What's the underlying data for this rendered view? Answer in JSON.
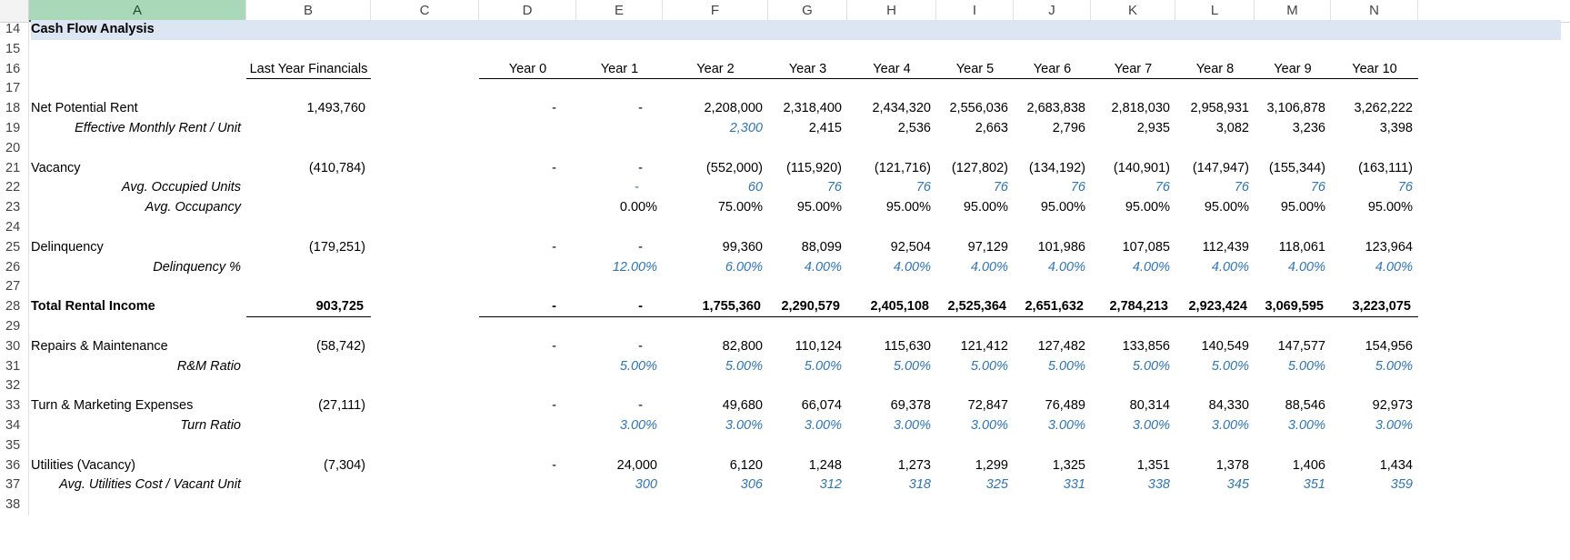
{
  "columns": [
    "A",
    "B",
    "C",
    "D",
    "E",
    "F",
    "G",
    "H",
    "I",
    "J",
    "K",
    "L",
    "M",
    "N"
  ],
  "rows": [
    {
      "num": "14",
      "cells": {
        "A": {
          "t": "Cash Flow Analysis",
          "s": "title"
        }
      }
    },
    {
      "num": "15",
      "cells": {}
    },
    {
      "num": "16",
      "cells": {
        "B": {
          "t": "Last Year Financials",
          "s": "hdr"
        },
        "D": {
          "t": "Year 0",
          "s": "hdr"
        },
        "E": {
          "t": "Year 1",
          "s": "hdr"
        },
        "F": {
          "t": "Year 2",
          "s": "hdr"
        },
        "G": {
          "t": "Year 3",
          "s": "hdr"
        },
        "H": {
          "t": "Year 4",
          "s": "hdr"
        },
        "I": {
          "t": "Year 5",
          "s": "hdr"
        },
        "J": {
          "t": "Year 6",
          "s": "hdr"
        },
        "K": {
          "t": "Year 7",
          "s": "hdr"
        },
        "L": {
          "t": "Year 8",
          "s": "hdr"
        },
        "M": {
          "t": "Year 9",
          "s": "hdr"
        },
        "N": {
          "t": "Year 10",
          "s": "hdr"
        }
      }
    },
    {
      "num": "17",
      "cells": {}
    },
    {
      "num": "18",
      "cells": {
        "A": {
          "t": "Net Potential Rent",
          "s": "label"
        },
        "B": {
          "t": "1,493,760",
          "s": "num"
        },
        "D": {
          "t": "-",
          "s": "dash"
        },
        "E": {
          "t": "-",
          "s": "dash"
        },
        "F": {
          "t": "2,208,000",
          "s": "num"
        },
        "G": {
          "t": "2,318,400",
          "s": "num"
        },
        "H": {
          "t": "2,434,320",
          "s": "num"
        },
        "I": {
          "t": "2,556,036",
          "s": "num"
        },
        "J": {
          "t": "2,683,838",
          "s": "num"
        },
        "K": {
          "t": "2,818,030",
          "s": "num"
        },
        "L": {
          "t": "2,958,931",
          "s": "num"
        },
        "M": {
          "t": "3,106,878",
          "s": "num"
        },
        "N": {
          "t": "3,262,222",
          "s": "num"
        }
      }
    },
    {
      "num": "19",
      "cells": {
        "A": {
          "t": "Effective Monthly Rent / Unit",
          "s": "sublabel"
        },
        "F": {
          "t": "2,300",
          "s": "bluenum"
        },
        "G": {
          "t": "2,415",
          "s": "num"
        },
        "H": {
          "t": "2,536",
          "s": "num"
        },
        "I": {
          "t": "2,663",
          "s": "num"
        },
        "J": {
          "t": "2,796",
          "s": "num"
        },
        "K": {
          "t": "2,935",
          "s": "num"
        },
        "L": {
          "t": "3,082",
          "s": "num"
        },
        "M": {
          "t": "3,236",
          "s": "num"
        },
        "N": {
          "t": "3,398",
          "s": "num"
        }
      }
    },
    {
      "num": "20",
      "cells": {}
    },
    {
      "num": "21",
      "cells": {
        "A": {
          "t": "Vacancy",
          "s": "label"
        },
        "B": {
          "t": "(410,784)",
          "s": "num"
        },
        "D": {
          "t": "-",
          "s": "dash"
        },
        "E": {
          "t": "-",
          "s": "dash"
        },
        "F": {
          "t": "(552,000)",
          "s": "num"
        },
        "G": {
          "t": "(115,920)",
          "s": "num"
        },
        "H": {
          "t": "(121,716)",
          "s": "num"
        },
        "I": {
          "t": "(127,802)",
          "s": "num"
        },
        "J": {
          "t": "(134,192)",
          "s": "num"
        },
        "K": {
          "t": "(140,901)",
          "s": "num"
        },
        "L": {
          "t": "(147,947)",
          "s": "num"
        },
        "M": {
          "t": "(155,344)",
          "s": "num"
        },
        "N": {
          "t": "(163,111)",
          "s": "num"
        }
      }
    },
    {
      "num": "22",
      "cells": {
        "A": {
          "t": "Avg. Occupied Units",
          "s": "sublabel"
        },
        "E": {
          "t": "-",
          "s": "bluedash"
        },
        "F": {
          "t": "60",
          "s": "bluenum"
        },
        "G": {
          "t": "76",
          "s": "bluenum"
        },
        "H": {
          "t": "76",
          "s": "bluenum"
        },
        "I": {
          "t": "76",
          "s": "bluenum"
        },
        "J": {
          "t": "76",
          "s": "bluenum"
        },
        "K": {
          "t": "76",
          "s": "bluenum"
        },
        "L": {
          "t": "76",
          "s": "bluenum"
        },
        "M": {
          "t": "76",
          "s": "bluenum"
        },
        "N": {
          "t": "76",
          "s": "bluenum"
        }
      }
    },
    {
      "num": "23",
      "cells": {
        "A": {
          "t": "Avg. Occupancy",
          "s": "sublabel"
        },
        "E": {
          "t": "0.00%",
          "s": "num"
        },
        "F": {
          "t": "75.00%",
          "s": "num"
        },
        "G": {
          "t": "95.00%",
          "s": "num"
        },
        "H": {
          "t": "95.00%",
          "s": "num"
        },
        "I": {
          "t": "95.00%",
          "s": "num"
        },
        "J": {
          "t": "95.00%",
          "s": "num"
        },
        "K": {
          "t": "95.00%",
          "s": "num"
        },
        "L": {
          "t": "95.00%",
          "s": "num"
        },
        "M": {
          "t": "95.00%",
          "s": "num"
        },
        "N": {
          "t": "95.00%",
          "s": "num"
        }
      }
    },
    {
      "num": "24",
      "cells": {}
    },
    {
      "num": "25",
      "cells": {
        "A": {
          "t": "Delinquency",
          "s": "label"
        },
        "B": {
          "t": "(179,251)",
          "s": "num"
        },
        "D": {
          "t": "-",
          "s": "dash"
        },
        "E": {
          "t": "-",
          "s": "dash"
        },
        "F": {
          "t": "99,360",
          "s": "num"
        },
        "G": {
          "t": "88,099",
          "s": "num"
        },
        "H": {
          "t": "92,504",
          "s": "num"
        },
        "I": {
          "t": "97,129",
          "s": "num"
        },
        "J": {
          "t": "101,986",
          "s": "num"
        },
        "K": {
          "t": "107,085",
          "s": "num"
        },
        "L": {
          "t": "112,439",
          "s": "num"
        },
        "M": {
          "t": "118,061",
          "s": "num"
        },
        "N": {
          "t": "123,964",
          "s": "num"
        }
      }
    },
    {
      "num": "26",
      "cells": {
        "A": {
          "t": "Delinquency %",
          "s": "sublabel"
        },
        "E": {
          "t": "12.00%",
          "s": "bluepct"
        },
        "F": {
          "t": "6.00%",
          "s": "bluepct"
        },
        "G": {
          "t": "4.00%",
          "s": "bluepct"
        },
        "H": {
          "t": "4.00%",
          "s": "bluepct"
        },
        "I": {
          "t": "4.00%",
          "s": "bluepct"
        },
        "J": {
          "t": "4.00%",
          "s": "bluepct"
        },
        "K": {
          "t": "4.00%",
          "s": "bluepct"
        },
        "L": {
          "t": "4.00%",
          "s": "bluepct"
        },
        "M": {
          "t": "4.00%",
          "s": "bluepct"
        },
        "N": {
          "t": "4.00%",
          "s": "bluepct"
        }
      }
    },
    {
      "num": "27",
      "cells": {}
    },
    {
      "num": "28",
      "cells": {
        "A": {
          "t": "Total Rental Income",
          "s": "boldlabel"
        },
        "B": {
          "t": "903,725",
          "s": "boldnum"
        },
        "D": {
          "t": "-",
          "s": "bolddash"
        },
        "E": {
          "t": "-",
          "s": "bolddash"
        },
        "F": {
          "t": "1,755,360",
          "s": "boldnum"
        },
        "G": {
          "t": "2,290,579",
          "s": "boldnum"
        },
        "H": {
          "t": "2,405,108",
          "s": "boldnum"
        },
        "I": {
          "t": "2,525,364",
          "s": "boldnum"
        },
        "J": {
          "t": "2,651,632",
          "s": "boldnum"
        },
        "K": {
          "t": "2,784,213",
          "s": "boldnum"
        },
        "L": {
          "t": "2,923,424",
          "s": "boldnum"
        },
        "M": {
          "t": "3,069,595",
          "s": "boldnum"
        },
        "N": {
          "t": "3,223,075",
          "s": "boldnum"
        }
      }
    },
    {
      "num": "29",
      "cells": {}
    },
    {
      "num": "30",
      "cells": {
        "A": {
          "t": "Repairs & Maintenance",
          "s": "label"
        },
        "B": {
          "t": "(58,742)",
          "s": "num"
        },
        "D": {
          "t": "-",
          "s": "dash"
        },
        "E": {
          "t": "-",
          "s": "dash"
        },
        "F": {
          "t": "82,800",
          "s": "num"
        },
        "G": {
          "t": "110,124",
          "s": "num"
        },
        "H": {
          "t": "115,630",
          "s": "num"
        },
        "I": {
          "t": "121,412",
          "s": "num"
        },
        "J": {
          "t": "127,482",
          "s": "num"
        },
        "K": {
          "t": "133,856",
          "s": "num"
        },
        "L": {
          "t": "140,549",
          "s": "num"
        },
        "M": {
          "t": "147,577",
          "s": "num"
        },
        "N": {
          "t": "154,956",
          "s": "num"
        }
      }
    },
    {
      "num": "31",
      "cells": {
        "A": {
          "t": "R&M Ratio",
          "s": "sublabel"
        },
        "E": {
          "t": "5.00%",
          "s": "bluepct"
        },
        "F": {
          "t": "5.00%",
          "s": "bluepct"
        },
        "G": {
          "t": "5.00%",
          "s": "bluepct"
        },
        "H": {
          "t": "5.00%",
          "s": "bluepct"
        },
        "I": {
          "t": "5.00%",
          "s": "bluepct"
        },
        "J": {
          "t": "5.00%",
          "s": "bluepct"
        },
        "K": {
          "t": "5.00%",
          "s": "bluepct"
        },
        "L": {
          "t": "5.00%",
          "s": "bluepct"
        },
        "M": {
          "t": "5.00%",
          "s": "bluepct"
        },
        "N": {
          "t": "5.00%",
          "s": "bluepct"
        }
      }
    },
    {
      "num": "32",
      "cells": {}
    },
    {
      "num": "33",
      "cells": {
        "A": {
          "t": "Turn & Marketing Expenses",
          "s": "label"
        },
        "B": {
          "t": "(27,111)",
          "s": "num"
        },
        "D": {
          "t": "-",
          "s": "dash"
        },
        "E": {
          "t": "-",
          "s": "dash"
        },
        "F": {
          "t": "49,680",
          "s": "num"
        },
        "G": {
          "t": "66,074",
          "s": "num"
        },
        "H": {
          "t": "69,378",
          "s": "num"
        },
        "I": {
          "t": "72,847",
          "s": "num"
        },
        "J": {
          "t": "76,489",
          "s": "num"
        },
        "K": {
          "t": "80,314",
          "s": "num"
        },
        "L": {
          "t": "84,330",
          "s": "num"
        },
        "M": {
          "t": "88,546",
          "s": "num"
        },
        "N": {
          "t": "92,973",
          "s": "num"
        }
      }
    },
    {
      "num": "34",
      "cells": {
        "A": {
          "t": "Turn Ratio",
          "s": "sublabel"
        },
        "E": {
          "t": "3.00%",
          "s": "bluepct"
        },
        "F": {
          "t": "3.00%",
          "s": "bluepct"
        },
        "G": {
          "t": "3.00%",
          "s": "bluepct"
        },
        "H": {
          "t": "3.00%",
          "s": "bluepct"
        },
        "I": {
          "t": "3.00%",
          "s": "bluepct"
        },
        "J": {
          "t": "3.00%",
          "s": "bluepct"
        },
        "K": {
          "t": "3.00%",
          "s": "bluepct"
        },
        "L": {
          "t": "3.00%",
          "s": "bluepct"
        },
        "M": {
          "t": "3.00%",
          "s": "bluepct"
        },
        "N": {
          "t": "3.00%",
          "s": "bluepct"
        }
      }
    },
    {
      "num": "35",
      "cells": {}
    },
    {
      "num": "36",
      "cells": {
        "A": {
          "t": "Utilities (Vacancy)",
          "s": "label"
        },
        "B": {
          "t": "(7,304)",
          "s": "num"
        },
        "D": {
          "t": "-",
          "s": "dash"
        },
        "E": {
          "t": "24,000",
          "s": "num"
        },
        "F": {
          "t": "6,120",
          "s": "num"
        },
        "G": {
          "t": "1,248",
          "s": "num"
        },
        "H": {
          "t": "1,273",
          "s": "num"
        },
        "I": {
          "t": "1,299",
          "s": "num"
        },
        "J": {
          "t": "1,325",
          "s": "num"
        },
        "K": {
          "t": "1,351",
          "s": "num"
        },
        "L": {
          "t": "1,378",
          "s": "num"
        },
        "M": {
          "t": "1,406",
          "s": "num"
        },
        "N": {
          "t": "1,434",
          "s": "num"
        }
      }
    },
    {
      "num": "37",
      "cells": {
        "A": {
          "t": "Avg. Utilities Cost / Vacant Unit",
          "s": "sublabel"
        },
        "E": {
          "t": "300",
          "s": "bluenum"
        },
        "F": {
          "t": "306",
          "s": "bluenum"
        },
        "G": {
          "t": "312",
          "s": "bluenum"
        },
        "H": {
          "t": "318",
          "s": "bluenum"
        },
        "I": {
          "t": "325",
          "s": "bluenum"
        },
        "J": {
          "t": "331",
          "s": "bluenum"
        },
        "K": {
          "t": "338",
          "s": "bluenum"
        },
        "L": {
          "t": "345",
          "s": "bluenum"
        },
        "M": {
          "t": "351",
          "s": "bluenum"
        },
        "N": {
          "t": "359",
          "s": "bluenum"
        }
      }
    },
    {
      "num": "38",
      "cells": {}
    }
  ],
  "selected_column": "A",
  "colors": {
    "title_band": "#dce6f2",
    "input_blue": "#2e75b6",
    "selected_header": "#a9d8b8"
  }
}
